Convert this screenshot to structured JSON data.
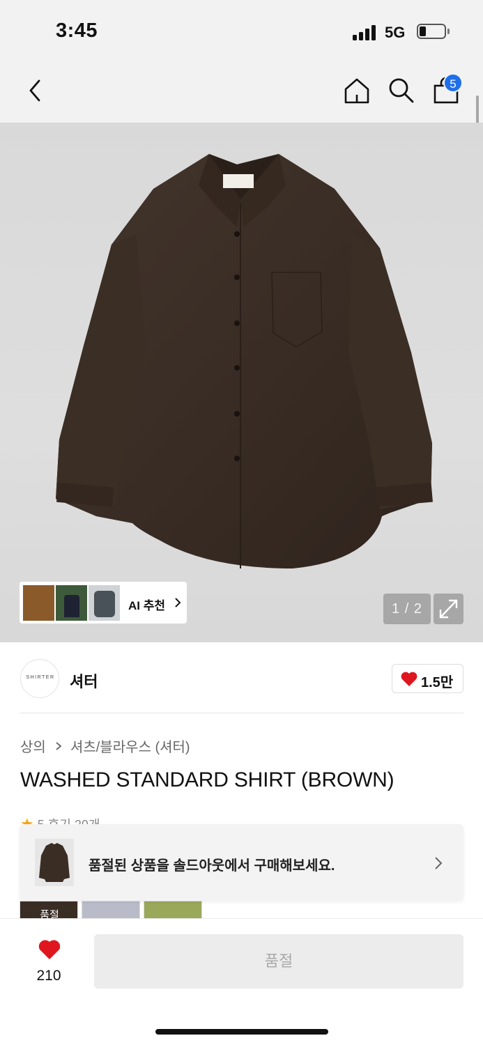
{
  "status_bar": {
    "time": "3:45",
    "network": "5G"
  },
  "nav": {
    "cart_count": "5"
  },
  "gallery": {
    "ai_label": "AI 추천",
    "page_indicator": "1 / 2"
  },
  "brand": {
    "logo_text": "SHIRTER",
    "name": "셔터",
    "likes": "1.5만"
  },
  "product": {
    "breadcrumb": [
      "상의",
      "셔츠/블라우스 (셔터)"
    ],
    "title": "WASHED STANDARD SHIRT (BROWN)",
    "rating_text": "5 후기 20개"
  },
  "toast": {
    "message": "품절된 상품을 솔드아웃에서 구매해보세요."
  },
  "color_options": {
    "sold_label": "품절"
  },
  "bottom_bar": {
    "like_count": "210",
    "soldout_label": "품절"
  },
  "colors": {
    "accent_badge": "#1f6feb",
    "heart_red": "#e0161e",
    "shirt_brown": "#3a2d24"
  }
}
